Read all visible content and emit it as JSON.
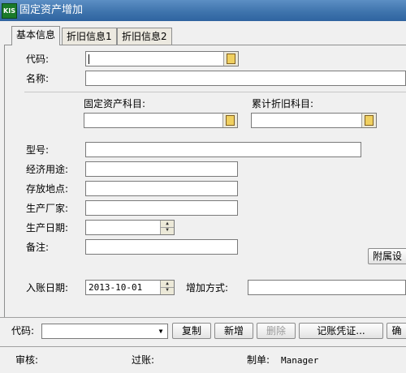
{
  "window": {
    "title": "固定资产增加",
    "app_badge": "KIS"
  },
  "tabs": [
    {
      "label": "基本信息"
    },
    {
      "label": "折旧信息1"
    },
    {
      "label": "折旧信息2"
    }
  ],
  "form": {
    "code_label": "代码:",
    "name_label": "名称:",
    "asset_account_label": "固定资产科目:",
    "depr_account_label": "累计折旧科目:",
    "model_label": "型号:",
    "purpose_label": "经济用途:",
    "location_label": "存放地点:",
    "maker_label": "生产厂家:",
    "prod_date_label": "生产日期:",
    "note_label": "备注:",
    "attach_button": "附属设",
    "entry_date_label": "入账日期:",
    "entry_date_value": "2013-10-01",
    "add_method_label": "增加方式:"
  },
  "toolbar": {
    "code_label": "代码:",
    "copy": "复制",
    "add": "新增",
    "delete": "删除",
    "voucher": "记账凭证...",
    "ok": "确"
  },
  "status": {
    "audit_label": "审核:",
    "post_label": "过账:",
    "maker_label": "制单:",
    "maker_value": "Manager"
  }
}
